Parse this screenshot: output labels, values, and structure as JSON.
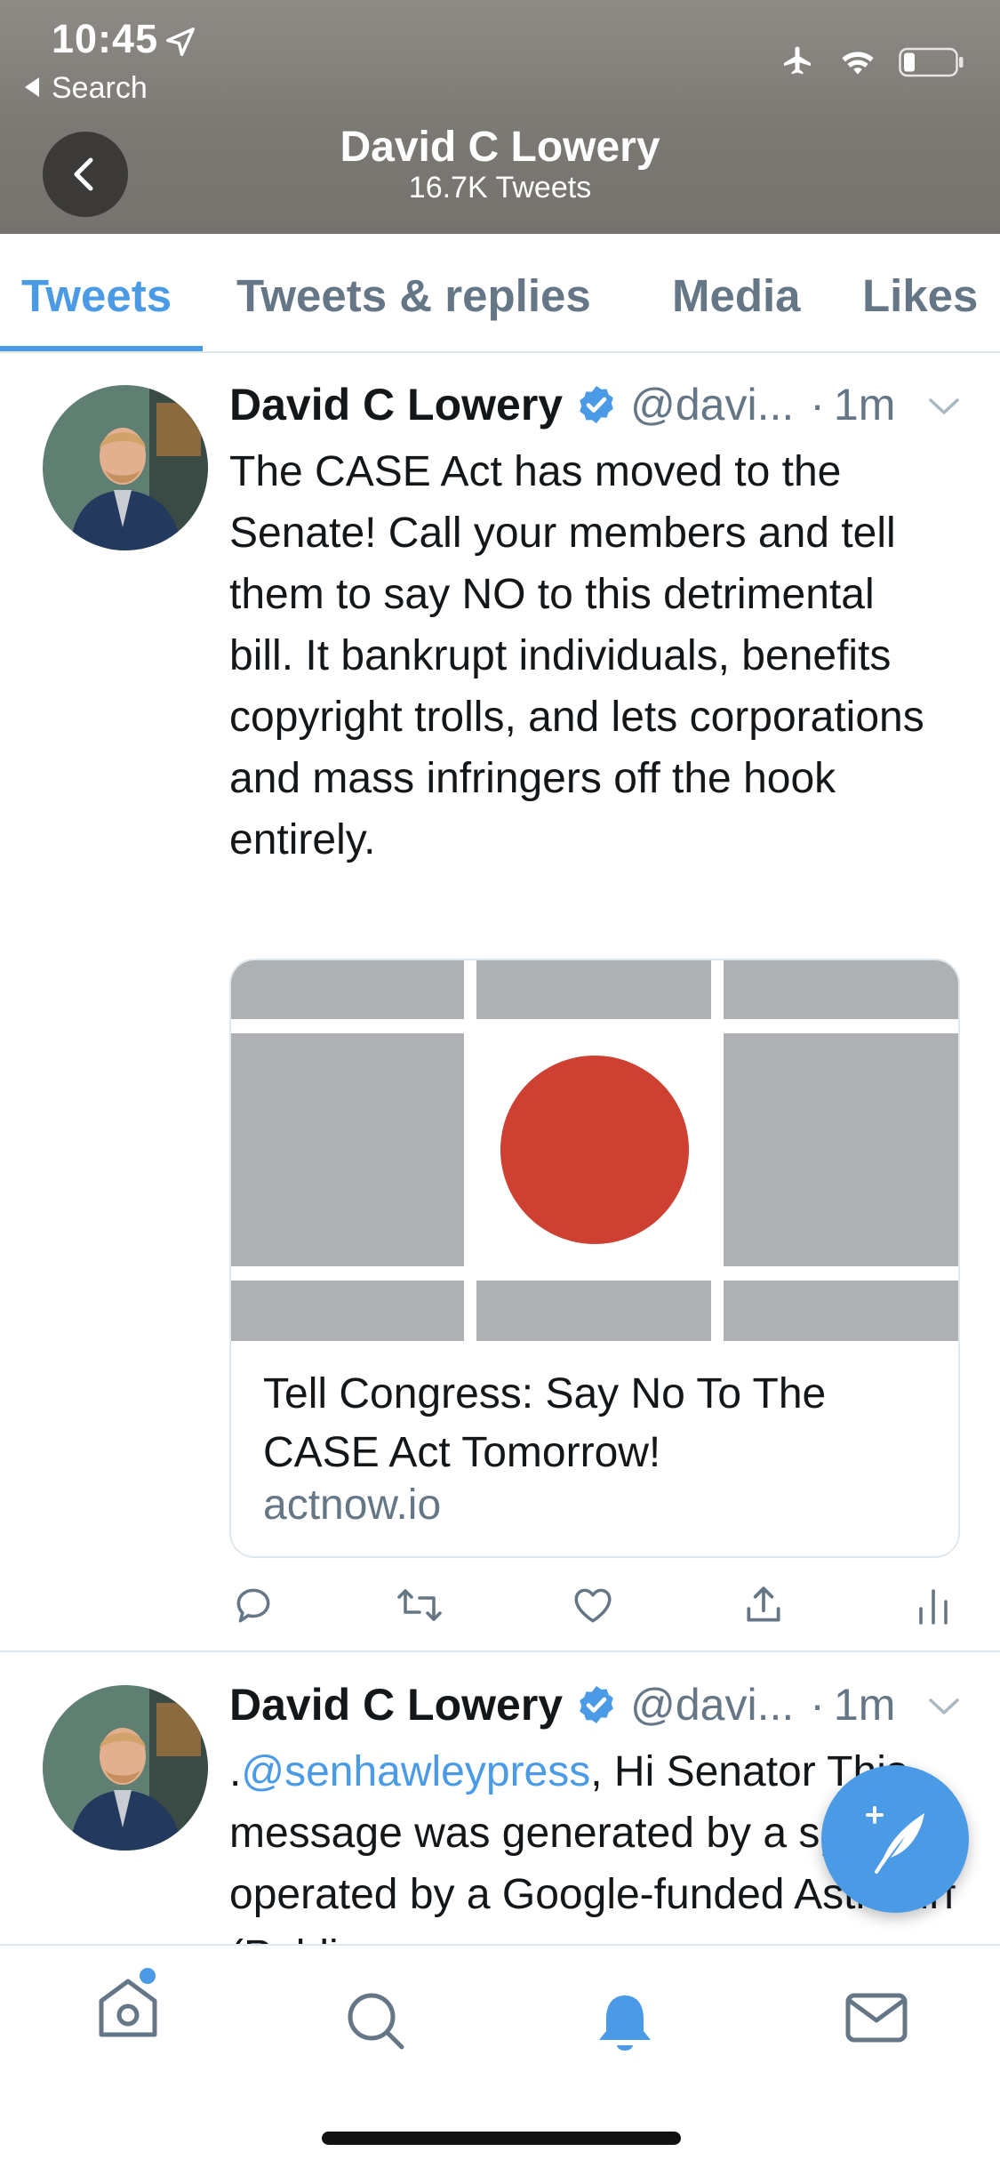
{
  "status_bar": {
    "time": "10:45",
    "back_app_label": "Search"
  },
  "header": {
    "title": "David C Lowery",
    "subtitle": "16.7K Tweets"
  },
  "tabs": [
    {
      "label": "Tweets",
      "active": true
    },
    {
      "label": "Tweets & replies",
      "active": false
    },
    {
      "label": "Media",
      "active": false
    },
    {
      "label": "Likes",
      "active": false
    }
  ],
  "tweets": [
    {
      "name": "David C Lowery",
      "handle": "@davi...",
      "dot": "·",
      "time": "1m",
      "text": "The CASE Act has moved to the Senate! Call your members and tell them to say NO to this detrimental bill. It bankrupt individuals, benefits copyright trolls, and lets corporations and mass infringers off the hook entirely.",
      "card": {
        "title": "Tell Congress: Say No To The CASE Act Tomorrow!",
        "domain": "actnow.io"
      }
    },
    {
      "name": "David C Lowery",
      "handle": "@davi...",
      "dot": "·",
      "time": "1m",
      "text_prefix": ".",
      "mention": "@senhawleypress",
      "text_rest": ", Hi Senator This message was generated by a spambot operated by a Google-funded Astroturf (Public"
    }
  ],
  "colors": {
    "accent": "#4a9ae6",
    "header_bg": "#807d78",
    "secondary_text": "#657786",
    "card_red": "#cd4032",
    "card_gray": "#afb0b3"
  },
  "icons": {
    "status": [
      "location-arrow-icon",
      "airplane-icon",
      "wifi-icon",
      "battery-icon"
    ],
    "actions": [
      "reply-icon",
      "retweet-icon",
      "like-icon",
      "share-icon",
      "analytics-icon"
    ],
    "nav": [
      "home-icon",
      "search-icon",
      "notifications-bell-icon",
      "messages-envelope-icon"
    ]
  }
}
